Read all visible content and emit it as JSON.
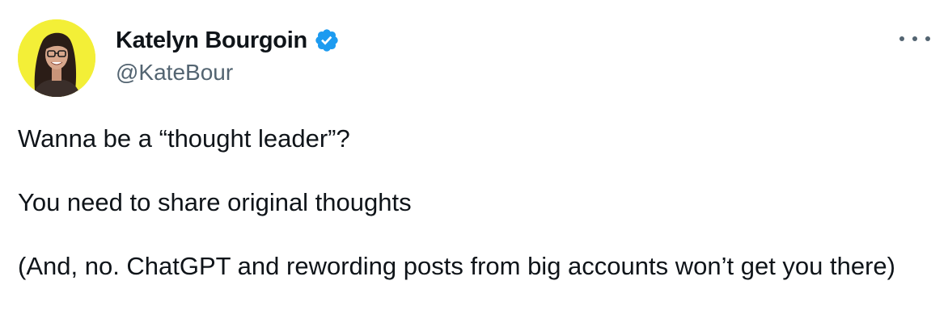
{
  "author": {
    "display_name": "Katelyn Bourgoin",
    "handle": "@KateBour",
    "verified": true,
    "avatar_bg": "#f3ef37",
    "verified_color": "#1d9bf0"
  },
  "menu": {
    "icon": "more-horizontal-icon"
  },
  "tweet": {
    "paragraphs": [
      "Wanna be a “thought leader”?",
      "You need to share original thoughts",
      "(And, no. ChatGPT and rewording posts from big accounts won’t get you there)"
    ]
  }
}
